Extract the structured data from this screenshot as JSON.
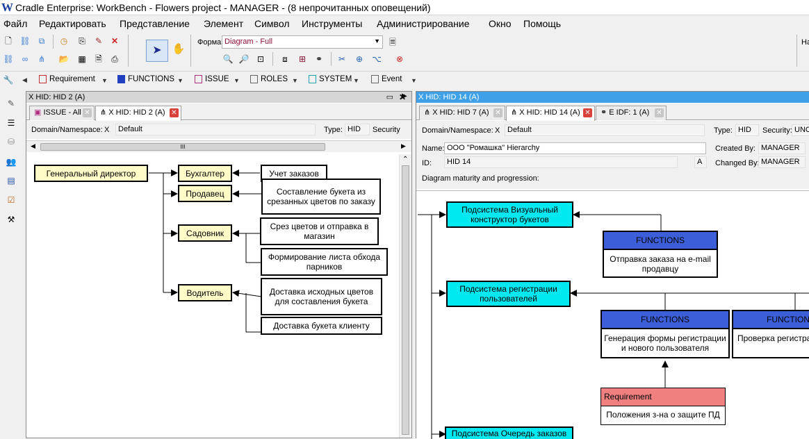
{
  "window": {
    "title": "Cradle Enterprise: WorkBench - Flowers project - MANAGER - (8 непрочитанных оповещений)",
    "logo": "W"
  },
  "menu": [
    "Файл",
    "Редактировать",
    "Представление",
    "Элемент",
    "Символ",
    "Инструменты",
    "Администрирование",
    "Окно",
    "Помощь"
  ],
  "toolbar": {
    "form_label": "Форма",
    "form_value": "Diagram - Full",
    "right_cut": "На"
  },
  "type_buttons": [
    {
      "label": "Requirement",
      "color": "#c03030"
    },
    {
      "label": "FUNCTIONS",
      "color": "#2040c0"
    },
    {
      "label": "ISSUE",
      "color": "#b03080"
    },
    {
      "label": "ROLES",
      "color": "#707070"
    },
    {
      "label": "SYSTEM",
      "color": "#20a0b0"
    },
    {
      "label": "Event",
      "color": "#707070"
    }
  ],
  "left_pane": {
    "header": "X HID: HID 2 (A)",
    "tabs": [
      "ISSUE - All",
      "X HID: HID 2 (A)"
    ],
    "domain_label": "Domain/Namespace:",
    "domain_x": "X",
    "domain_value": "Default",
    "type_label": "Type:",
    "type_value": "HID",
    "security_label": "Security",
    "scroll_grip": "III",
    "nodes": {
      "director": "Генеральный директор",
      "accountant": "Бухгалтер",
      "seller": "Продавец",
      "gardener": "Садовник",
      "driver": "Водитель",
      "orders": "Учет заказов",
      "bouquet": "Составление букета из срезанных цветов по заказу",
      "cut": "Срез цветов и отправка в магазин",
      "list": "Формирование листа обхода парников",
      "delivery_src": "Доставка исходных цветов для составления букета",
      "delivery_client": "Доставка букета клиенту"
    }
  },
  "right_pane": {
    "header": "X HID: HID 14 (A)",
    "tabs": [
      "X HID: HID 7 (A)",
      "X HID: HID 14 (A)",
      "E IDF: 1 (A)"
    ],
    "domain_label": "Domain/Namespace:",
    "domain_x": "X",
    "domain_value": "Default",
    "type_label": "Type:",
    "type_value": "HID",
    "security_label": "Security:",
    "security_value": "UNC",
    "name_label": "Name:",
    "name_value": "ООО \"Ромашка\" Hierarchy",
    "created_label": "Created By:",
    "created_value": "MANAGER",
    "id_label": "ID:",
    "id_value": "HID 14",
    "id_suffix": "A",
    "changed_label": "Changed By:",
    "changed_value": "MANAGER",
    "maturity_label": "Diagram maturity and progression:",
    "nodes": {
      "sub1": "Подсистема Визуальный конструктор букетов",
      "fn1_head": "FUNCTIONS",
      "fn1_body": "Отправка заказа на e-mail продавцу",
      "sub2": "Подсистема регистрации пользователей",
      "fn2_head": "FUNCTIONS",
      "fn2_body": "Генерация формы регистрации и нового пользователя",
      "fn3_head": "FUNCTION",
      "fn3_body": "Проверка регистрационных данных",
      "req_head": "Requirement",
      "req_body": "Положения з-на о защите ПД",
      "sub3": "Подсистема Очередь заказов"
    }
  }
}
